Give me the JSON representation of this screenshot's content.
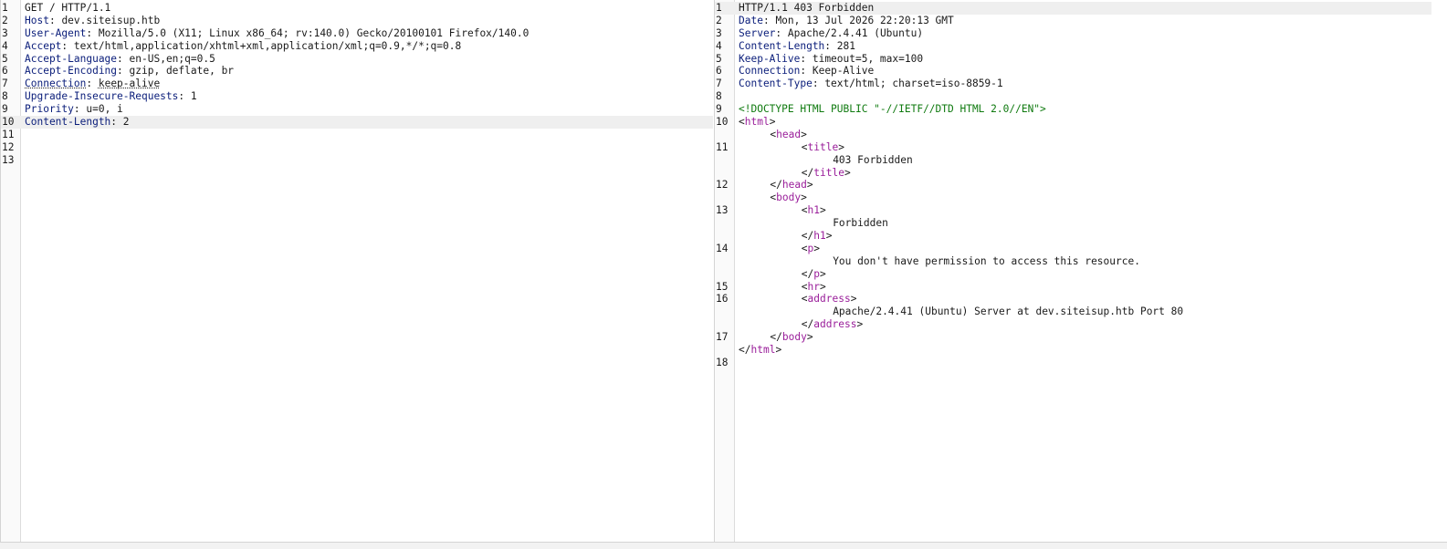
{
  "request": {
    "lines": [
      {
        "n": "1",
        "name": "",
        "sep": "",
        "value": "GET / HTTP/1.1"
      },
      {
        "n": "2",
        "name": "Host",
        "sep": ": ",
        "value": "dev.siteisup.htb"
      },
      {
        "n": "3",
        "name": "User-Agent",
        "sep": ": ",
        "value": "Mozilla/5.0 (X11; Linux x86_64; rv:140.0) Gecko/20100101 Firefox/140.0"
      },
      {
        "n": "4",
        "name": "Accept",
        "sep": ": ",
        "value": "text/html,application/xhtml+xml,application/xml;q=0.9,*/*;q=0.8"
      },
      {
        "n": "5",
        "name": "Accept-Language",
        "sep": ": ",
        "value": "en-US,en;q=0.5"
      },
      {
        "n": "6",
        "name": "Accept-Encoding",
        "sep": ": ",
        "value": "gzip, deflate, br"
      },
      {
        "n": "7",
        "name": "Connection",
        "sep": ": ",
        "value": "keep-alive"
      },
      {
        "n": "8",
        "name": "Upgrade-Insecure-Requests",
        "sep": ": ",
        "value": "1"
      },
      {
        "n": "9",
        "name": "Priority",
        "sep": ": ",
        "value": "u=0, i"
      },
      {
        "n": "10",
        "name": "Content-Length",
        "sep": ": ",
        "value": "2"
      },
      {
        "n": "11",
        "name": "",
        "sep": "",
        "value": ""
      },
      {
        "n": "12",
        "name": "",
        "sep": "",
        "value": ""
      },
      {
        "n": "13",
        "name": "",
        "sep": "",
        "value": ""
      }
    ]
  },
  "response": {
    "headers": [
      {
        "n": "1",
        "name": "",
        "sep": "",
        "value": "HTTP/1.1 403 Forbidden"
      },
      {
        "n": "2",
        "name": "Date",
        "sep": ": ",
        "value": "Mon, 13 Jul 2026 22:20:13 GMT"
      },
      {
        "n": "3",
        "name": "Server",
        "sep": ": ",
        "value": "Apache/2.4.41 (Ubuntu)"
      },
      {
        "n": "4",
        "name": "Content-Length",
        "sep": ": ",
        "value": "281"
      },
      {
        "n": "5",
        "name": "Keep-Alive",
        "sep": ": ",
        "value": "timeout=5, max=100"
      },
      {
        "n": "6",
        "name": "Connection",
        "sep": ": ",
        "value": "Keep-Alive"
      },
      {
        "n": "7",
        "name": "Content-Type",
        "sep": ": ",
        "value": "text/html; charset=iso-8859-1"
      },
      {
        "n": "8",
        "name": "",
        "sep": "",
        "value": ""
      }
    ],
    "body": [
      {
        "n": "9",
        "indent": 0,
        "kind": "doctype",
        "text": "<!DOCTYPE HTML PUBLIC \"-//IETF//DTD HTML 2.0//EN\">"
      },
      {
        "n": "10",
        "indent": 0,
        "kind": "open",
        "tag": "html"
      },
      {
        "n": "",
        "indent": 1,
        "kind": "open",
        "tag": "head"
      },
      {
        "n": "11",
        "indent": 2,
        "kind": "open",
        "tag": "title"
      },
      {
        "n": "",
        "indent": 3,
        "kind": "text",
        "text": "403 Forbidden"
      },
      {
        "n": "",
        "indent": 2,
        "kind": "close",
        "tag": "title"
      },
      {
        "n": "12",
        "indent": 1,
        "kind": "close",
        "tag": "head"
      },
      {
        "n": "",
        "indent": 1,
        "kind": "open",
        "tag": "body"
      },
      {
        "n": "13",
        "indent": 2,
        "kind": "open",
        "tag": "h1"
      },
      {
        "n": "",
        "indent": 3,
        "kind": "text",
        "text": "Forbidden"
      },
      {
        "n": "",
        "indent": 2,
        "kind": "close",
        "tag": "h1"
      },
      {
        "n": "14",
        "indent": 2,
        "kind": "open",
        "tag": "p"
      },
      {
        "n": "",
        "indent": 3,
        "kind": "text",
        "text": "You don't have permission to access this resource."
      },
      {
        "n": "",
        "indent": 2,
        "kind": "close",
        "tag": "p"
      },
      {
        "n": "15",
        "indent": 2,
        "kind": "open",
        "tag": "hr"
      },
      {
        "n": "16",
        "indent": 2,
        "kind": "open",
        "tag": "address"
      },
      {
        "n": "",
        "indent": 3,
        "kind": "text",
        "text": "Apache/2.4.41 (Ubuntu) Server at dev.siteisup.htb Port 80"
      },
      {
        "n": "",
        "indent": 2,
        "kind": "close",
        "tag": "address"
      },
      {
        "n": "17",
        "indent": 1,
        "kind": "close",
        "tag": "body"
      },
      {
        "n": "",
        "indent": 0,
        "kind": "close",
        "tag": "html"
      },
      {
        "n": "18",
        "indent": 0,
        "kind": "blank"
      }
    ]
  }
}
